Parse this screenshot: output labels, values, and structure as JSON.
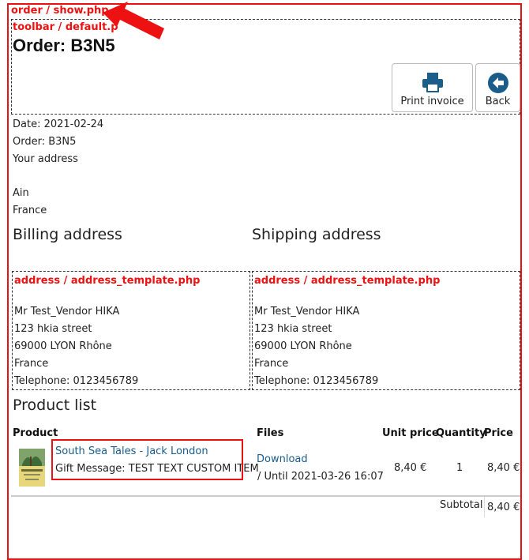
{
  "template_labels": {
    "order": "order / show.php",
    "toolbar": "toolbar / default.p",
    "address_billing": "address / address_template.php",
    "address_shipping": "address / address_template.php"
  },
  "order": {
    "title": "Order: B3N5",
    "date": "Date: 2021-02-24",
    "number": "Order: B3N5",
    "your_address_label": "Your address",
    "your_address_region": "Ain",
    "your_address_country": "France"
  },
  "toolbar": {
    "print_label": "Print invoice",
    "print_icon": "printer-icon",
    "back_label": "Back",
    "back_icon": "arrow-left-circle-icon",
    "accent": "#1a5c8a"
  },
  "billing": {
    "heading": "Billing address",
    "name": "Mr Test_Vendor HIKA",
    "street": "123 hkia street",
    "city": "69000 LYON Rhône",
    "country": "France",
    "phone": "Telephone: 0123456789"
  },
  "shipping": {
    "heading": "Shipping address",
    "name": "Mr Test_Vendor HIKA",
    "street": "123 hkia street",
    "city": "69000 LYON Rhône",
    "country": "France",
    "phone": "Telephone: 0123456789"
  },
  "products": {
    "heading": "Product list",
    "columns": [
      "Product",
      "Files",
      "Unit price",
      "Quantity",
      "Price"
    ],
    "rows": [
      {
        "name": "South Sea Tales - Jack London",
        "gift_message": "Gift Message: TEST TEXT CUSTOM ITEM",
        "file_link": "Download",
        "file_until": "/ Until 2021-03-26 16:07",
        "unit_price": "8,40 €",
        "quantity": "1",
        "price": "8,40 €"
      }
    ],
    "subtotal_label": "Subtotal",
    "subtotal_value": "8,40 €"
  },
  "colors": {
    "highlight": "#e11",
    "link": "#1a5c8a"
  }
}
